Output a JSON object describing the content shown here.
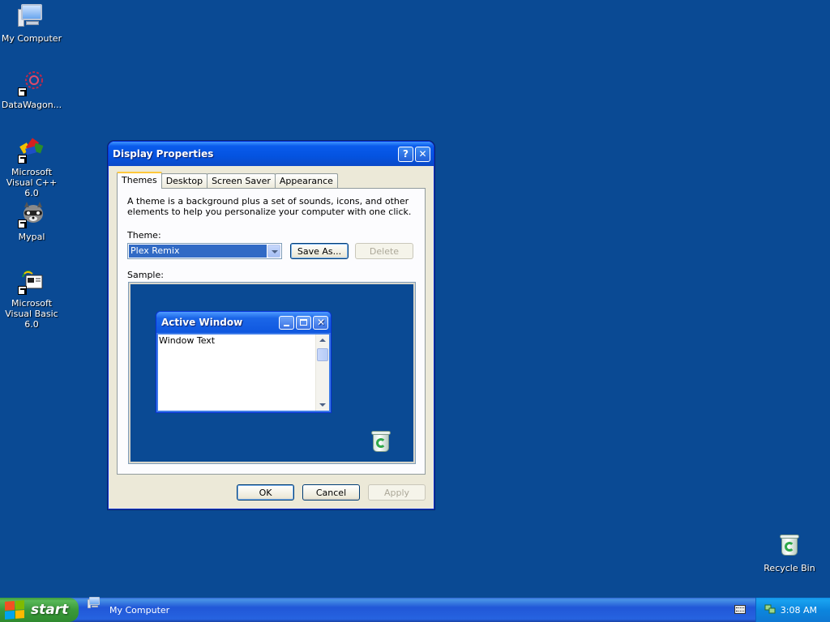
{
  "desktop": {
    "icons": [
      {
        "label": "My Computer",
        "icon": "my-computer-icon"
      },
      {
        "label": "DataWagon...",
        "icon": "datawagon-icon"
      },
      {
        "label": "Microsoft Visual C++ 6.0",
        "icon": "visual-cpp-icon"
      },
      {
        "label": "Mypal",
        "icon": "mypal-raccoon-icon"
      },
      {
        "label": "Microsoft Visual Basic 6.0",
        "icon": "visual-basic-icon"
      },
      {
        "label": "Recycle Bin",
        "icon": "recycle-bin-icon"
      }
    ],
    "background_color": "#0a4a94"
  },
  "dialog": {
    "title": "Display Properties",
    "help_button": "?",
    "close_button": "✕",
    "tabs": [
      {
        "label": "Themes",
        "active": true
      },
      {
        "label": "Desktop",
        "active": false
      },
      {
        "label": "Screen Saver",
        "active": false
      },
      {
        "label": "Appearance",
        "active": false
      }
    ],
    "description": "A theme is a background plus a set of sounds, icons, and other elements to help you personalize your computer with one click.",
    "theme_label": "Theme:",
    "theme_value": "Plex Remix",
    "save_as_label": "Save As...",
    "delete_label": "Delete",
    "sample_label": "Sample:",
    "sample": {
      "window_title": "Active Window",
      "window_text": "Window Text"
    },
    "ok_label": "OK",
    "cancel_label": "Cancel",
    "apply_label": "Apply"
  },
  "taskbar": {
    "start_label": "start",
    "tasks": [
      {
        "label": "My Computer"
      }
    ],
    "clock": "3:08 AM"
  },
  "colors": {
    "titlebar": "#0453e0",
    "start_green": "#3a9a3a",
    "tray_blue": "#0c86de",
    "selection": "#316ac5"
  }
}
